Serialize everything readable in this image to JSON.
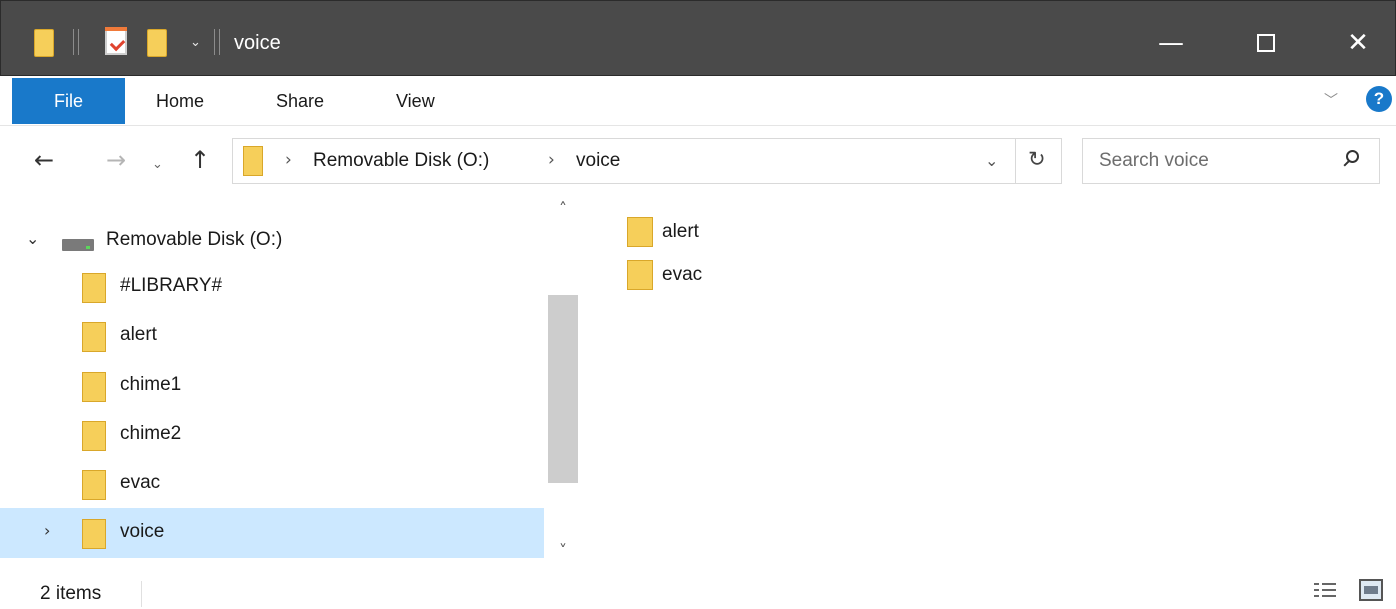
{
  "window": {
    "title": "voice",
    "minimize_label": "—",
    "close_label": "✕"
  },
  "ribbon": {
    "tabs": [
      "File",
      "Home",
      "Share",
      "View"
    ]
  },
  "address": {
    "back_glyph": "←",
    "forward_glyph": "→",
    "recent_glyph": "⌄",
    "up_glyph": "↑",
    "separator": "›",
    "breadcrumbs": [
      "Removable Disk (O:)",
      "voice"
    ],
    "dropdown_glyph": "⌄",
    "refresh_glyph": "↻"
  },
  "search": {
    "placeholder": "Search voice"
  },
  "navpane": {
    "expanded_glyph": "⌄",
    "collapsed_glyph": "›",
    "root": "Removable Disk (O:)",
    "items": [
      "#LIBRARY#",
      "alert",
      "chime1",
      "chime2",
      "evac",
      "voice"
    ],
    "selected": "voice",
    "scroll_up_glyph": "˄",
    "scroll_down_glyph": "˅"
  },
  "content": {
    "items": [
      "alert",
      "evac"
    ]
  },
  "status": {
    "item_count": "2 items"
  },
  "colors": {
    "titlebar": "#4a4a4a",
    "file_tab": "#1979ca",
    "selection": "#cce8ff",
    "folder": "#f6cf5a"
  }
}
